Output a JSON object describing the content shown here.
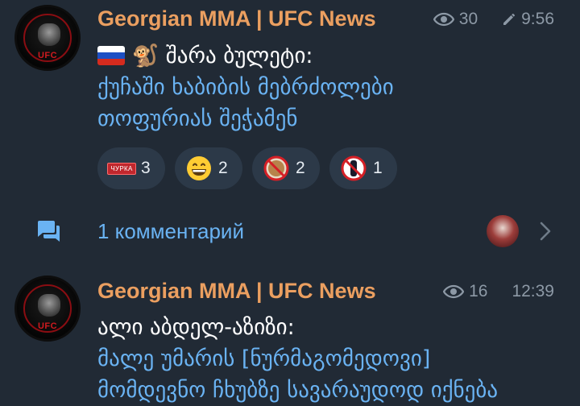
{
  "posts": [
    {
      "channel": "Georgian MMA | UFC News",
      "views": "30",
      "time": "9:56",
      "edited": true,
      "lines": [
        "🐒 შარა ბულეტი:",
        "ქუჩაში ხაბიბის მებრძოლები",
        "თოფურიას შეჭამენ"
      ],
      "reactions": [
        {
          "icon": "chupa-sticker-icon",
          "chip_text": "ЧУРКА",
          "count": "3"
        },
        {
          "icon": "grinning-face-icon",
          "emoji": "😁",
          "count": "2"
        },
        {
          "icon": "prohibited-sticker-icon",
          "count": "2"
        },
        {
          "icon": "prohibited-figure-icon",
          "count": "1"
        }
      ],
      "comments_label": "1 комментарий"
    },
    {
      "channel": "Georgian MMA | UFC News",
      "views": "16",
      "time": "12:39",
      "lines": [
        "ალი აბდელ-აზიზი:",
        "მალე უმარის [ნურმაგომედოვი]",
        "მომდევნო ჩხუბზე სავარაუდოდ იქნება"
      ]
    }
  ],
  "colors": {
    "background": "#212a35",
    "channel": "#eb9f60",
    "link": "#6ab3f3",
    "meta": "#8d99a6",
    "reaction_bg": "#2c3948"
  }
}
